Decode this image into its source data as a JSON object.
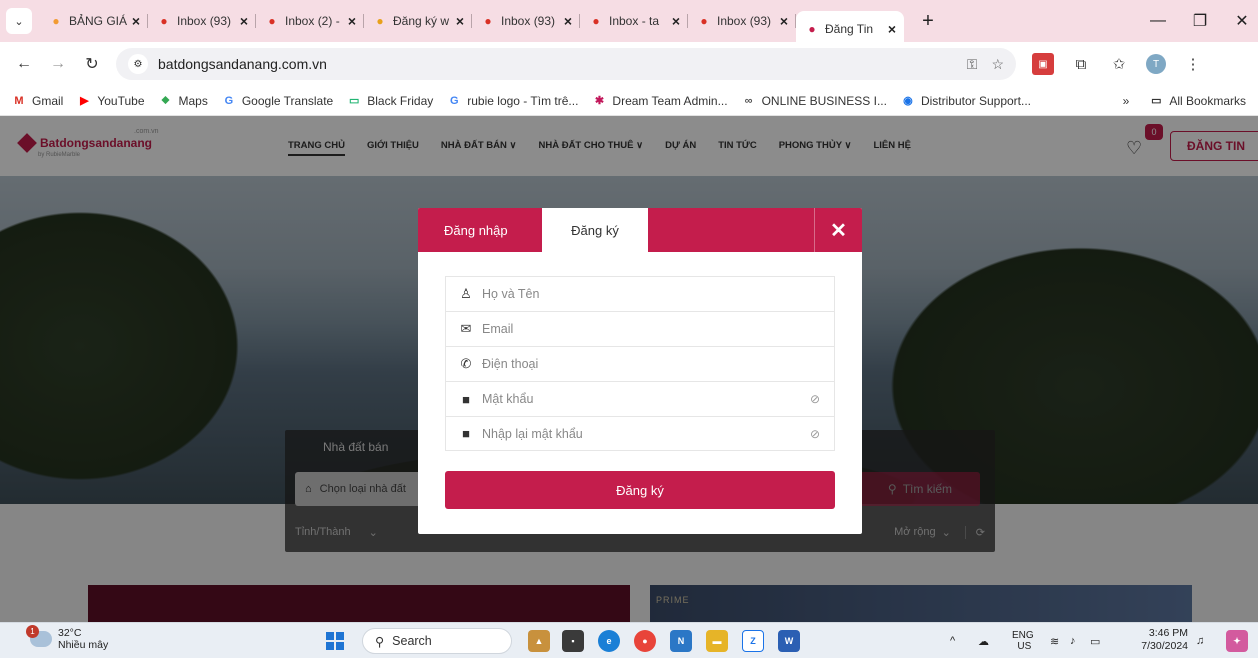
{
  "browser": {
    "tabs": [
      {
        "title": "BẢNG GIÁ",
        "icon": "sun-icon",
        "color": "#f29b32"
      },
      {
        "title": "Inbox (93)",
        "icon": "gmail-icon",
        "color": "#d93025"
      },
      {
        "title": "Inbox (2) -",
        "icon": "gmail-icon",
        "color": "#d93025"
      },
      {
        "title": "Đăng ký w",
        "icon": "pin-icon",
        "color": "#e8a11a"
      },
      {
        "title": "Inbox (93)",
        "icon": "gmail-icon",
        "color": "#d93025"
      },
      {
        "title": "Inbox - ta",
        "icon": "gmail-icon",
        "color": "#d93025"
      },
      {
        "title": "Inbox (93)",
        "icon": "gmail-icon",
        "color": "#d93025"
      },
      {
        "title": "Đăng Tin",
        "icon": "location-icon",
        "color": "#c41d4c",
        "active": true
      }
    ],
    "url": "batdongsandanang.com.vn",
    "bookmarks": [
      {
        "label": "Gmail",
        "icon": "gmail-icon"
      },
      {
        "label": "YouTube",
        "icon": "youtube-icon"
      },
      {
        "label": "Maps",
        "icon": "maps-icon"
      },
      {
        "label": "Google Translate",
        "icon": "translate-icon"
      },
      {
        "label": "Black Friday",
        "icon": "tag-icon"
      },
      {
        "label": "rubie logo - Tìm trê...",
        "icon": "google-icon"
      },
      {
        "label": "Dream Team Admin...",
        "icon": "asterisk-icon"
      },
      {
        "label": "ONLINE BUSINESS I...",
        "icon": "ring-icon"
      },
      {
        "label": "Distributor Support...",
        "icon": "globe-icon"
      }
    ],
    "bookmarks_more": "»",
    "all_bookmarks": "All Bookmarks"
  },
  "site": {
    "logo_text": "Batdongsandanang",
    "logo_sub": "by RubieMarble",
    "logo_com": ".com.vn",
    "nav": [
      {
        "label": "TRANG CHỦ",
        "active": true
      },
      {
        "label": "GIỚI THIỆU"
      },
      {
        "label": "NHÀ ĐẤT BÁN ∨"
      },
      {
        "label": "NHÀ ĐẤT CHO THUÊ ∨"
      },
      {
        "label": "DỰ ÁN"
      },
      {
        "label": "TIN TỨC"
      },
      {
        "label": "PHONG THỦY ∨"
      },
      {
        "label": "LIÊN HỆ"
      }
    ],
    "favorites_count": "0",
    "post_button": "ĐĂNG TIN",
    "search_panel": {
      "tab": "Nhà đất bán",
      "field_placeholder": "Chọn loại nhà đất",
      "search_button": "Tìm kiếm",
      "province": "Tỉnh/Thành",
      "expand": "Mở rộng"
    },
    "card2_label": "PRIME"
  },
  "modal": {
    "tab_login": "Đăng nhập",
    "tab_register": "Đăng ký",
    "close": "✕",
    "fields": [
      {
        "placeholder": "Họ và Tên",
        "icon": "user-icon"
      },
      {
        "placeholder": "Email",
        "icon": "envelope-icon"
      },
      {
        "placeholder": "Điện thoại",
        "icon": "phone-icon"
      },
      {
        "placeholder": "Mật khẩu",
        "icon": "lock-icon",
        "eye": true
      },
      {
        "placeholder": "Nhập lại mật khẩu",
        "icon": "lock-icon",
        "eye": true
      }
    ],
    "submit": "Đăng ký"
  },
  "taskbar": {
    "weather_temp": "32°C",
    "weather_desc": "Nhiều mây",
    "weather_badge": "1",
    "search": "Search",
    "lang_top": "ENG",
    "lang_bottom": "US",
    "time": "3:46 PM",
    "date": "7/30/2024"
  },
  "colors": {
    "brand": "#c41d4c",
    "tabstrip": "#f6dde4"
  }
}
